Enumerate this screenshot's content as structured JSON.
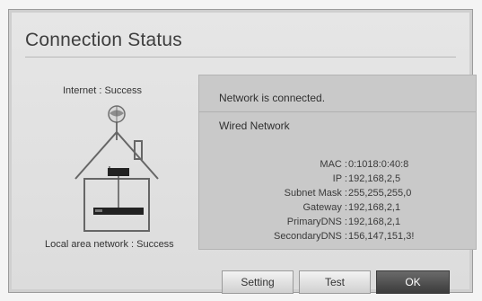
{
  "dialog": {
    "title": "Connection Status",
    "internet_label": "Internet : Success",
    "lan_label": "Local area network : Success",
    "status": "Network is connected.",
    "network_type": "Wired Network",
    "details": [
      {
        "key": "MAC",
        "value": "0:1018:0:40:8"
      },
      {
        "key": "IP",
        "value": "192,168,2,5"
      },
      {
        "key": "Subnet Mask",
        "value": "255,255,255,0"
      },
      {
        "key": "Gateway",
        "value": "192,168,2,1"
      },
      {
        "key": "PrimaryDNS",
        "value": "192,168,2,1"
      },
      {
        "key": "SecondaryDNS",
        "value": "156,147,151,3!"
      }
    ],
    "buttons": {
      "setting": "Setting",
      "test": "Test",
      "ok": "OK"
    }
  }
}
